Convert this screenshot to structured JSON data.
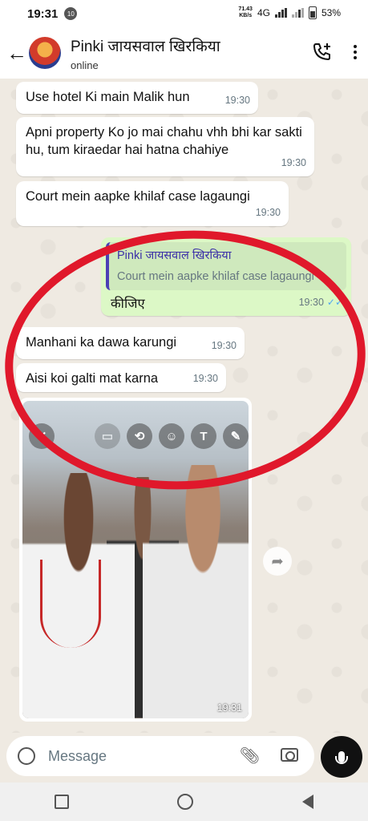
{
  "status": {
    "time": "19:31",
    "notif_badge": "10",
    "net_speed_val": "71.43",
    "net_speed_unit": "KB/s",
    "network": "4G",
    "battery": "53%"
  },
  "header": {
    "contact_name": "Pinki जायसवाल खिरकिया",
    "status": "online"
  },
  "messages": [
    {
      "text": "Use hotel Ki main Malik hun",
      "time": "19:30"
    },
    {
      "text": "Apni property Ko jo mai chahu vhh bhi kar sakti hu, tum kiraedar hai hatna chahiye",
      "time": "19:30"
    },
    {
      "text": "Court mein aapke khilaf case lagaungi",
      "time": "19:30"
    },
    {
      "quote_name": "Pinki जायसवाल खिरकिया",
      "quote_text": "Court mein aapke khilaf case lagaungi",
      "text": "कीजिए",
      "time": "19:30"
    },
    {
      "text": "Manhani ka dawa karungi",
      "time": "19:30"
    },
    {
      "text": "Aisi koi galti mat karna",
      "time": "19:30"
    }
  ],
  "photo": {
    "time": "19:31",
    "edit_text_tool": "T"
  },
  "composer": {
    "placeholder": "Message"
  },
  "colors": {
    "outgoing_bubble": "#dcf8c6",
    "incoming_bubble": "#ffffff",
    "chat_bg": "#efeae2",
    "annotation_ring": "#e0182b",
    "read_ticks": "#4fa6f2"
  }
}
